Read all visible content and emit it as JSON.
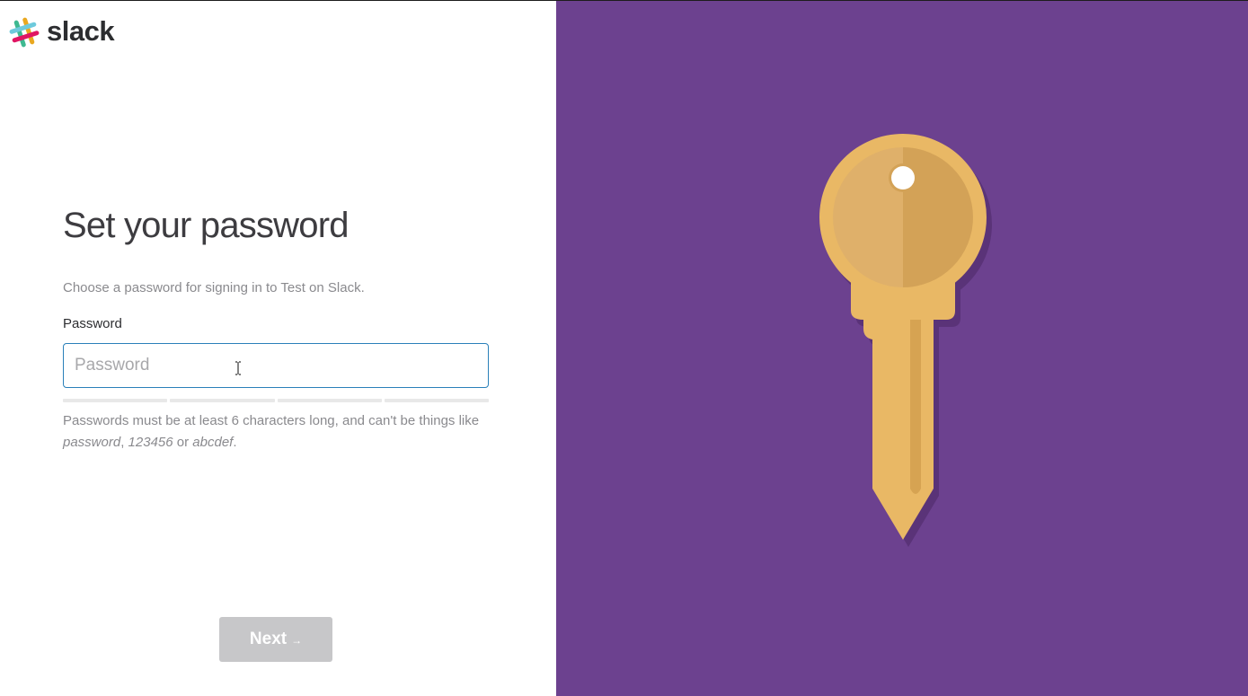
{
  "brand": {
    "name": "slack",
    "logo_icon": "slack-hash-logo"
  },
  "page": {
    "title": "Set your password",
    "subtitle": "Choose a password for signing in to Test on Slack."
  },
  "form": {
    "password_label": "Password",
    "password_value": "",
    "password_placeholder": "Password",
    "strength_segments": 4,
    "hint_prefix": "Passwords must be at least 6 characters long, and can't be things like ",
    "hint_example_1": "password",
    "hint_sep_1": ", ",
    "hint_example_2": "123456",
    "hint_sep_2": " or ",
    "hint_example_3": "abcdef",
    "hint_suffix": "."
  },
  "actions": {
    "next_label": "Next",
    "next_arrow": "→"
  },
  "illustration": {
    "icon": "key-icon"
  },
  "colors": {
    "panel_purple": "#6c418f",
    "key_gold": "#e9b865",
    "input_focus_border": "#2a80b9",
    "button_disabled": "#c7c7c9"
  }
}
